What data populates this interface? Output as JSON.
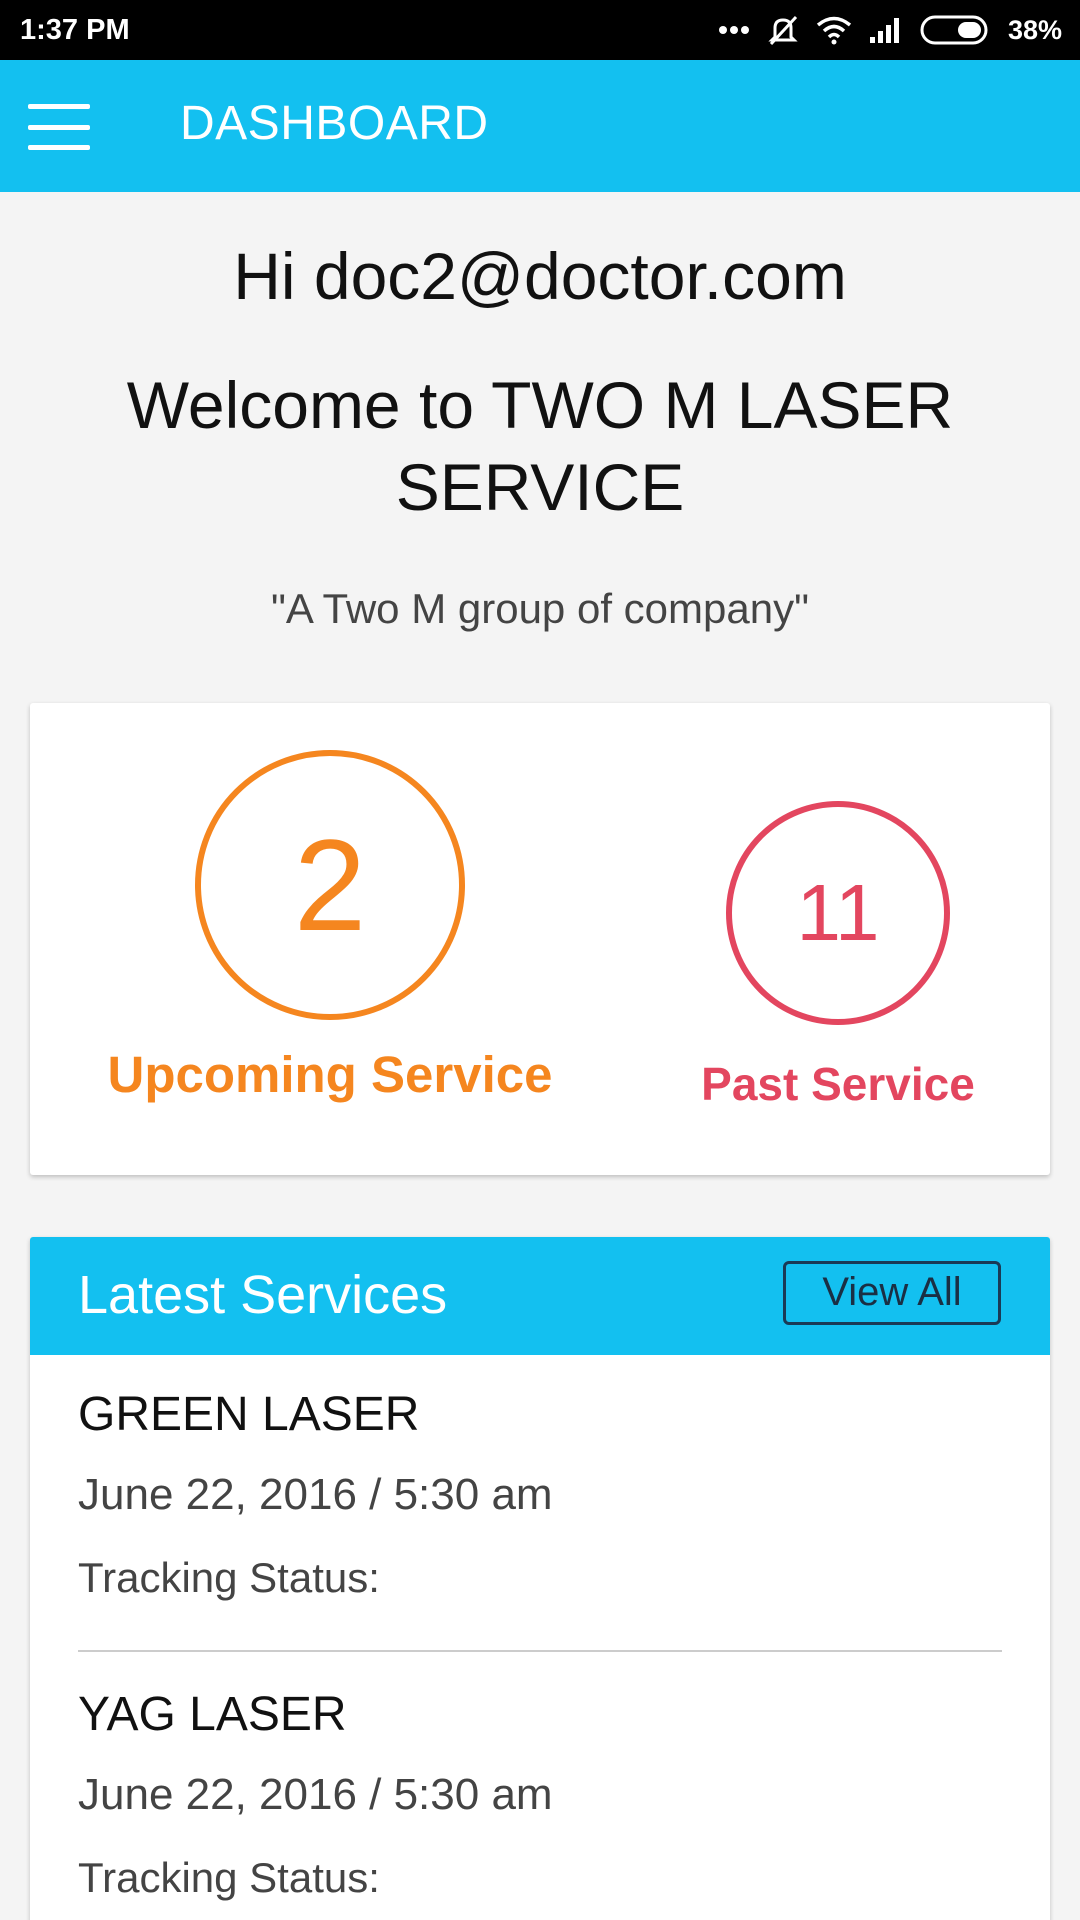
{
  "status_bar": {
    "time": "1:37 PM",
    "battery": "38%",
    "icons": [
      "more-dots-icon",
      "silent-icon",
      "wifi-icon",
      "signal-icon",
      "battery-icon"
    ]
  },
  "app_bar": {
    "title": "DASHBOARD",
    "menu_icon": "hamburger-menu-icon"
  },
  "greeting": "Hi doc2@doctor.com",
  "welcome": "Welcome to TWO M LASER SERVICE",
  "tagline": "\"A Two M group of company\"",
  "stats": {
    "upcoming": {
      "count": "2",
      "label": "Upcoming Service",
      "color": "#f5861f"
    },
    "past": {
      "count": "11",
      "label": "Past Service",
      "color": "#e3465f"
    }
  },
  "latest_services": {
    "title": "Latest Services",
    "view_all_label": "View All",
    "items": [
      {
        "name": "GREEN LASER",
        "datetime": "June 22, 2016  /  5:30 am",
        "status_label": "Tracking Status:"
      },
      {
        "name": "YAG LASER",
        "datetime": "June 22, 2016  /  5:30 am",
        "status_label": "Tracking Status:"
      }
    ]
  },
  "colors": {
    "accent": "#13c0f0",
    "upcoming": "#f5861f",
    "past": "#e3465f"
  }
}
